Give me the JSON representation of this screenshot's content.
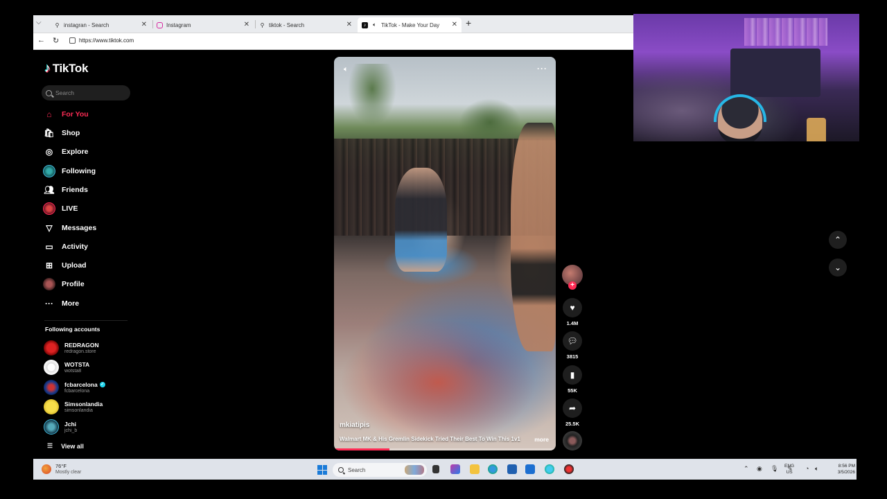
{
  "browser": {
    "tabs": [
      {
        "title": "instagran - Search",
        "icon": "search-icon"
      },
      {
        "title": "Instagram",
        "icon": "instagram-icon"
      },
      {
        "title": "tiktok - Search",
        "icon": "search-icon"
      },
      {
        "title": "TikTok - Make Your Day",
        "icon": "tiktok-icon"
      }
    ],
    "url": "https://www.tiktok.com"
  },
  "tiktok": {
    "logo_text": "TikTok",
    "search_placeholder": "Search",
    "nav": [
      {
        "label": "For You",
        "icon": "home-icon",
        "active": true
      },
      {
        "label": "Shop",
        "icon": "shop-icon"
      },
      {
        "label": "Explore",
        "icon": "compass-icon"
      },
      {
        "label": "Following",
        "icon": "following-avatar-icon"
      },
      {
        "label": "Friends",
        "icon": "friends-icon"
      },
      {
        "label": "LIVE",
        "icon": "live-icon"
      },
      {
        "label": "Messages",
        "icon": "messages-icon"
      },
      {
        "label": "Activity",
        "icon": "activity-icon"
      },
      {
        "label": "Upload",
        "icon": "upload-icon"
      },
      {
        "label": "Profile",
        "icon": "profile-avatar-icon"
      },
      {
        "label": "More",
        "icon": "more-icon"
      }
    ],
    "following_title": "Following accounts",
    "accounts": [
      {
        "name": "REDRAGON",
        "handle": "redragon.store",
        "verified": false
      },
      {
        "name": "WOTSTA",
        "handle": "wotsta8",
        "verified": false
      },
      {
        "name": "fcbarcelona",
        "handle": "fcbarcelona",
        "verified": true
      },
      {
        "name": "Simsonlandia",
        "handle": "simsonlandia",
        "verified": false
      },
      {
        "name": "Jchi",
        "handle": "jchi_b",
        "verified": false
      }
    ],
    "view_all": "View all",
    "video": {
      "author": "mkiatipis",
      "caption": "Walmart MK & His Gremlin Sidekick Tried Their Best To Win This 1v1",
      "more": "more",
      "progress": 0.25
    },
    "actions": {
      "likes": "1.4M",
      "comments": "3815",
      "saves": "55K",
      "shares": "25.5K"
    },
    "accent_color": "#fe2c55"
  },
  "taskbar": {
    "weather_temp": "76°F",
    "weather_desc": "Mostly clear",
    "search_placeholder": "Search",
    "lang_line1": "ENG",
    "lang_line2": "US",
    "time": "8:56 PM",
    "date": "3/5/2026"
  }
}
